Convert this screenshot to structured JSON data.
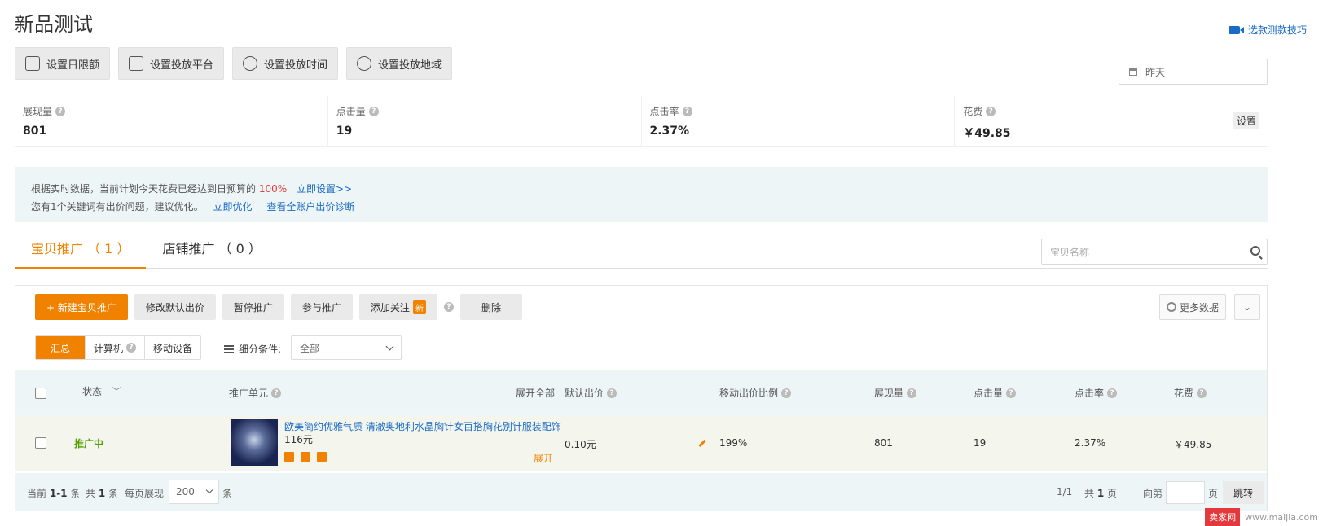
{
  "page": {
    "title": "新品测试",
    "tips_link": "选款测款技巧"
  },
  "toolbar": [
    {
      "label": "设置日限额",
      "icon": "sliders-icon"
    },
    {
      "label": "设置投放平台",
      "icon": "monitor-icon"
    },
    {
      "label": "设置投放时间",
      "icon": "stopwatch-icon"
    },
    {
      "label": "设置投放地域",
      "icon": "map-pin-icon"
    }
  ],
  "date_picker": {
    "value": "昨天"
  },
  "stats": [
    {
      "label": "展现量",
      "value": "801"
    },
    {
      "label": "点击量",
      "value": "19"
    },
    {
      "label": "点击率",
      "value": "2.37%"
    },
    {
      "label": "花费",
      "value": "￥49.85"
    }
  ],
  "stats_setting": "设置",
  "notice": {
    "line1_prefix": "根据实时数据，当前计划今天花费已经达到日预算的",
    "line1_percent": "100%",
    "line1_link": "立即设置>>",
    "line2_text": "您有1个关键词有出价问题，建议优化。",
    "line2_link1": "立即优化",
    "line2_link2": "查看全账户出价诊断"
  },
  "tabs": [
    {
      "label": "宝贝推广 （ 1 ）",
      "active": true
    },
    {
      "label": "店铺推广 （ 0 ）",
      "active": false
    }
  ],
  "search": {
    "placeholder": "宝贝名称"
  },
  "actions": {
    "new": "+ 新建宝贝推广",
    "edit_bid": "修改默认出价",
    "pause": "暂停推广",
    "join": "参与推广",
    "follow": "添加关注",
    "follow_badge": "新",
    "delete": "删除",
    "more_data": "更多数据"
  },
  "segments": {
    "summary": "汇总",
    "pc": "计算机",
    "mobile": "移动设备"
  },
  "filter": {
    "label": "细分条件:",
    "value": "全部"
  },
  "table": {
    "headers": {
      "status": "状态",
      "unit": "推广单元",
      "expand_all": "展开全部",
      "default_bid": "默认出价",
      "mobile_ratio": "移动出价比例",
      "impressions": "展现量",
      "clicks": "点击量",
      "ctr": "点击率",
      "cost": "花费"
    },
    "rows": [
      {
        "status": "推广中",
        "title": "欧美简约优雅气质 清澈奥地利水晶胸针女百搭胸花别针服装配饰",
        "price": "116元",
        "expand": "展开",
        "default_bid": "0.10元",
        "mobile_ratio": "199%",
        "impressions": "801",
        "clicks": "19",
        "ctr": "2.37%",
        "cost": "￥49.85"
      }
    ]
  },
  "footer": {
    "current_prefix": "当前",
    "current_range": "1-1",
    "current_suffix": "条",
    "total_prefix": "共",
    "total_count": "1",
    "total_suffix": "条",
    "per_page_label": "每页展现",
    "per_page_value": "200",
    "per_page_unit": "条",
    "page_pos": "1/1",
    "pages_prefix": "共",
    "pages_count": "1",
    "pages_suffix": "页",
    "goto_label": "向第",
    "goto_unit": "页",
    "jump": "跳转"
  },
  "watermark": {
    "brand": "卖家网",
    "url": "www.maijia.com"
  },
  "colors": {
    "accent": "#f08200",
    "link": "#1a6bc5",
    "status_green": "#52a000",
    "notice_bg": "#eef5f6"
  }
}
